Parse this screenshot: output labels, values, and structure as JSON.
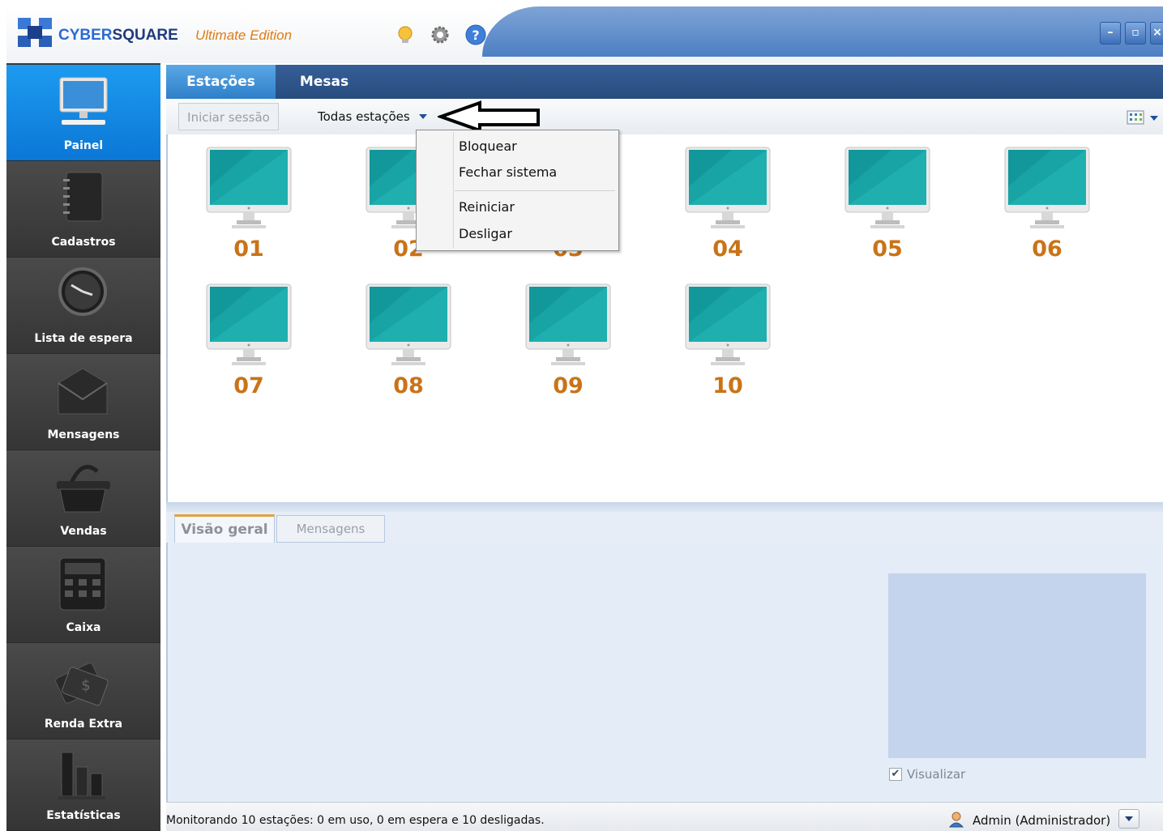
{
  "app": {
    "brand_part1": "CYBER",
    "brand_part2": "SQUARE",
    "edition": "Ultimate Edition",
    "title_icons": [
      "lightbulb-icon",
      "gear-icon",
      "help-icon"
    ],
    "window_buttons": [
      "minimize",
      "maximize",
      "close"
    ]
  },
  "sidebar": {
    "items": [
      {
        "label": "Painel",
        "icon": "monitor-icon",
        "active": true
      },
      {
        "label": "Cadastros",
        "icon": "notebook-icon",
        "active": false
      },
      {
        "label": "Lista de espera",
        "icon": "clock-icon",
        "active": false
      },
      {
        "label": "Mensagens",
        "icon": "envelope-icon",
        "active": false
      },
      {
        "label": "Vendas",
        "icon": "basket-icon",
        "active": false
      },
      {
        "label": "Caixa",
        "icon": "calculator-icon",
        "active": false
      },
      {
        "label": "Renda Extra",
        "icon": "money-icon",
        "active": false
      },
      {
        "label": "Estatísticas",
        "icon": "bar-chart-icon",
        "active": false
      }
    ]
  },
  "tabs": {
    "estacoes": "Estações",
    "mesas": "Mesas"
  },
  "toolbar": {
    "iniciar_label": "Iniciar sessão",
    "filter_label": "Todas estações"
  },
  "stations": [
    "01",
    "02",
    "03",
    "04",
    "05",
    "06",
    "07",
    "08",
    "09",
    "10"
  ],
  "context_menu": {
    "items": [
      "Bloquear",
      "Fechar sistema",
      "Reiniciar",
      "Desligar"
    ]
  },
  "bottom": {
    "tab_visao": "Visão geral",
    "tab_mensagens": "Mensagens",
    "visualizar_label": "Visualizar",
    "visualizar_checked": true
  },
  "status": {
    "text": "Monitorando 10 estações: 0 em uso, 0 em espera e 10 desligadas.",
    "user": "Admin (Administrador)"
  },
  "colors": {
    "accent_blue": "#1d9bf0",
    "station_number": "#c97318",
    "brand_orange": "#e07b12"
  }
}
